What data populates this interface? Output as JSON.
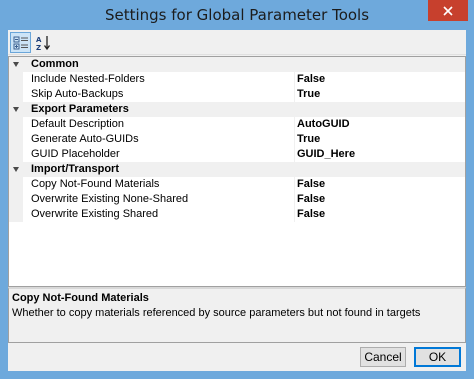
{
  "window": {
    "title": "Settings for Global Parameter Tools"
  },
  "toolbar": {
    "categorized_icon": "categorized-view-icon",
    "alphabetical_icon": "sort-alphabetical-icon",
    "alpha_top": "A",
    "alpha_bottom": "Z"
  },
  "grid": {
    "categories": [
      {
        "label": "Common",
        "properties": [
          {
            "name": "Include Nested-Folders",
            "value": "False"
          },
          {
            "name": "Skip Auto-Backups",
            "value": "True"
          }
        ]
      },
      {
        "label": "Export Parameters",
        "properties": [
          {
            "name": "Default Description",
            "value": "AutoGUID"
          },
          {
            "name": "Generate Auto-GUIDs",
            "value": "True"
          },
          {
            "name": "GUID Placeholder",
            "value": "GUID_Here"
          }
        ]
      },
      {
        "label": "Import/Transport",
        "properties": [
          {
            "name": "Copy Not-Found Materials",
            "value": "False"
          },
          {
            "name": "Overwrite Existing None-Shared",
            "value": "False"
          },
          {
            "name": "Overwrite Existing Shared",
            "value": "False"
          }
        ]
      }
    ]
  },
  "help": {
    "title": "Copy Not-Found Materials",
    "description": "Whether to copy materials referenced by source parameters but not found in targets"
  },
  "buttons": {
    "cancel": "Cancel",
    "ok": "OK"
  },
  "colors": {
    "titlebar": "#6ea9dc",
    "close": "#c7402d",
    "selection": "#cce4f7"
  }
}
